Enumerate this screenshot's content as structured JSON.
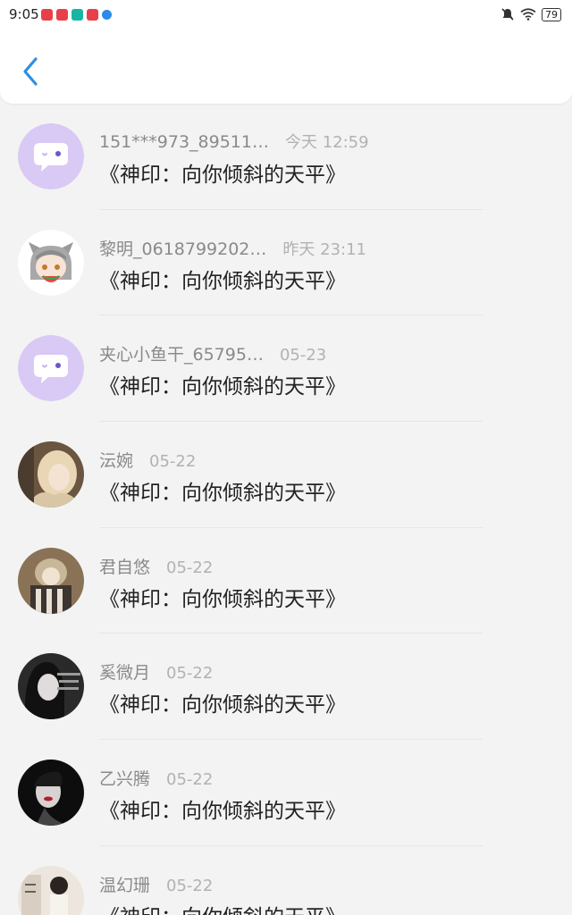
{
  "status_bar": {
    "time": "9:05",
    "battery": "79",
    "icons": [
      "app-notification-icon",
      "app-notification-icon",
      "app-notification-icon",
      "app-notification-icon",
      "app-notification-icon",
      "mute-icon",
      "wifi-icon",
      "battery-icon"
    ]
  },
  "header": {
    "back_icon": "chevron-left-icon",
    "accent_color": "#2f8fe0"
  },
  "comments": [
    {
      "name": "151***973_89511…",
      "time": "今天 12:59",
      "title": "《神印：向你倾斜的天平》",
      "avatar": "default-chat-avatar"
    },
    {
      "name": "黎明_0618799202…",
      "time": "昨天 23:11",
      "title": "《神印：向你倾斜的天平》",
      "avatar": "anime-catgirl-avatar"
    },
    {
      "name": "夹心小鱼干_65795…",
      "time": "05-23",
      "title": "《神印：向你倾斜的天平》",
      "avatar": "default-chat-avatar"
    },
    {
      "name": "沄婉",
      "time": "05-22",
      "title": "《神印：向你倾斜的天平》",
      "avatar": "photo-avatar"
    },
    {
      "name": "君自悠",
      "time": "05-22",
      "title": "《神印：向你倾斜的天平》",
      "avatar": "photo-avatar"
    },
    {
      "name": "奚微月",
      "time": "05-22",
      "title": "《神印：向你倾斜的天平》",
      "avatar": "photo-avatar"
    },
    {
      "name": "乙兴腾",
      "time": "05-22",
      "title": "《神印：向你倾斜的天平》",
      "avatar": "photo-avatar"
    },
    {
      "name": "温幻珊",
      "time": "05-22",
      "title": "《神印：向你倾斜的天平》",
      "avatar": "photo-avatar"
    }
  ]
}
